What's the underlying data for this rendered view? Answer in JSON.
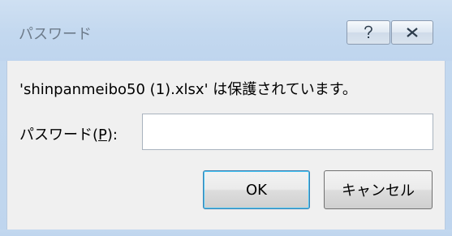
{
  "dialog": {
    "title": "パスワード",
    "message": "'shinpanmeibo50 (1).xlsx' は保護されています。",
    "password_label_prefix": "パスワード(",
    "password_label_mnemonic": "P",
    "password_label_suffix": "):",
    "password_value": "",
    "ok_label": "OK",
    "cancel_label": "キャンセル"
  },
  "titlebar_buttons": {
    "help_icon": "question-mark-icon",
    "close_icon": "close-x-icon"
  },
  "colors": {
    "titlebar": "#c3d8ef",
    "client_background": "#f0f0f0",
    "default_button_border": "#3c7fb1"
  }
}
